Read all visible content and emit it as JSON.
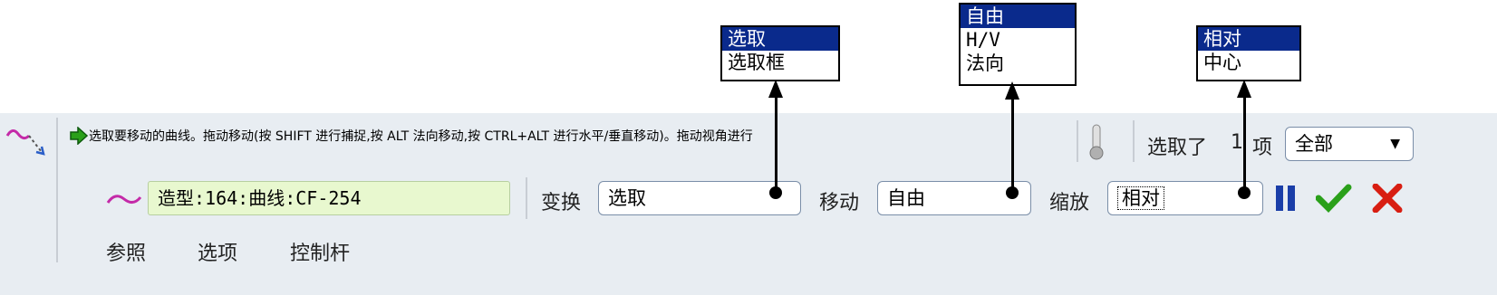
{
  "popups": {
    "transform": {
      "options": [
        "选取",
        "选取框"
      ],
      "selected": 0
    },
    "move": {
      "options": [
        "自由",
        "H/V",
        "法向"
      ],
      "selected": 0
    },
    "scale": {
      "options": [
        "相对",
        "中心"
      ],
      "selected": 0
    }
  },
  "message": "选取要移动的曲线。拖动移动(按 SHIFT 进行捕捉,按 ALT 法向移动,按 CTRL+ALT 进行水平/垂直移动)。拖动视角进行",
  "selection": {
    "label": "选取了",
    "count": "1",
    "unit": "项",
    "filter": "全部"
  },
  "reference": "造型:164:曲线:CF-254",
  "transform": {
    "label": "变换",
    "value": "选取"
  },
  "move": {
    "label": "移动",
    "value": "自由"
  },
  "scale": {
    "label": "缩放",
    "value": "相对"
  },
  "tabs": [
    "参照",
    "选项",
    "控制杆"
  ],
  "colors": {
    "accent_blue": "#0a2a8c",
    "check_green": "#2aa01a",
    "cancel_red": "#d81e12",
    "pause_blue": "#1a3ea8",
    "curve_pink": "#c42aa8"
  }
}
